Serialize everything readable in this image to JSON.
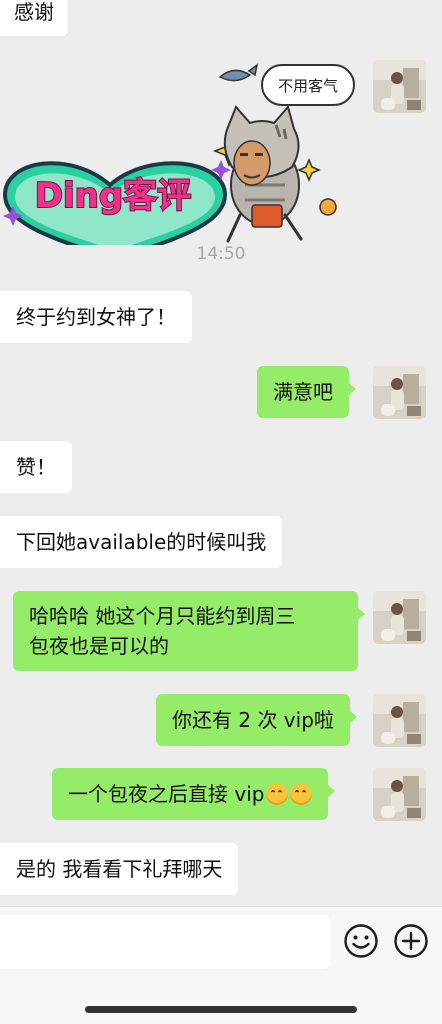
{
  "messages": [
    {
      "side": "left",
      "text": "感谢"
    },
    {
      "side": "right",
      "type": "sticker",
      "caption": "不用客气",
      "banner": "Ding客评"
    },
    {
      "side": "left",
      "text": "终于约到女神了！"
    },
    {
      "side": "right",
      "text": "满意吧"
    },
    {
      "side": "left",
      "text": "赞！"
    },
    {
      "side": "left",
      "text": "下回她available的时候叫我"
    },
    {
      "side": "right",
      "line1": "哈哈哈 她这个月只能约到周三",
      "line2": "包夜也是可以的"
    },
    {
      "side": "right",
      "text": "你还有 2 次 vip啦"
    },
    {
      "side": "right",
      "text": "一个包夜之后直接 vip",
      "emojis": [
        "blush-emoji",
        "blush-emoji"
      ]
    },
    {
      "side": "left",
      "text": "是的 我看看下礼拜哪天"
    }
  ],
  "timestamp": "14:50",
  "input_bar": {
    "input_value": "",
    "icons": [
      "smiley-icon",
      "plus-icon"
    ]
  },
  "colors": {
    "background": "#ededed",
    "outgoing_bubble": "#95ec69",
    "incoming_bubble": "#ffffff",
    "banner_pink": "#f0318c",
    "banner_green": "#2ad0a0"
  }
}
